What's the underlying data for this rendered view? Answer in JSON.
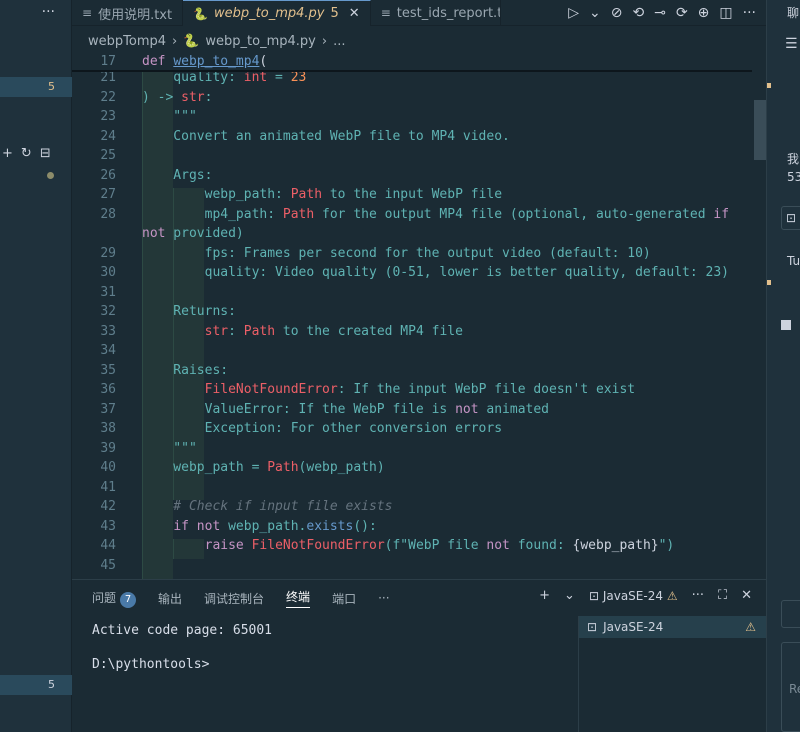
{
  "sidebar": {
    "menu": "···",
    "badge_top": "5",
    "badge_bottom": "5"
  },
  "tabs": [
    {
      "label": "使用说明.txt",
      "icon": "≡"
    },
    {
      "label": "webp_to_mp4.py",
      "icon": "py",
      "badge": "5"
    },
    {
      "label": "test_ids_report.t",
      "icon": "≡"
    }
  ],
  "breadcrumb": {
    "folder": "webpTomp4",
    "file": "webp_to_mp4.py",
    "more": "..."
  },
  "sticky": {
    "ln": "17",
    "def": "def",
    "name": "webp_to_mp4",
    "paren": "("
  },
  "code_lines": [
    {
      "ln": "21",
      "text": "    quality: int = 23"
    },
    {
      "ln": "22",
      "text": ") -> str:"
    },
    {
      "ln": "23",
      "text": "    \"\"\""
    },
    {
      "ln": "24",
      "text": "    Convert an animated WebP file to MP4 video."
    },
    {
      "ln": "25",
      "text": ""
    },
    {
      "ln": "26",
      "text": "    Args:"
    },
    {
      "ln": "27",
      "text": "        webp_path: Path to the input WebP file"
    },
    {
      "ln": "28",
      "text": "        mp4_path: Path for the output MP4 file (optional, auto-generated if"
    },
    {
      "ln": "",
      "text": "not provided)"
    },
    {
      "ln": "29",
      "text": "        fps: Frames per second for the output video (default: 10)"
    },
    {
      "ln": "30",
      "text": "        quality: Video quality (0-51, lower is better quality, default: 23)"
    },
    {
      "ln": "31",
      "text": ""
    },
    {
      "ln": "32",
      "text": "    Returns:"
    },
    {
      "ln": "33",
      "text": "        str: Path to the created MP4 file"
    },
    {
      "ln": "34",
      "text": ""
    },
    {
      "ln": "35",
      "text": "    Raises:"
    },
    {
      "ln": "36",
      "text": "        FileNotFoundError: If the input WebP file doesn't exist"
    },
    {
      "ln": "37",
      "text": "        ValueError: If the WebP file is not animated"
    },
    {
      "ln": "38",
      "text": "        Exception: For other conversion errors"
    },
    {
      "ln": "39",
      "text": "    \"\"\""
    },
    {
      "ln": "40",
      "text": "    webp_path = Path(webp_path)"
    },
    {
      "ln": "41",
      "text": ""
    },
    {
      "ln": "42",
      "text": "    # Check if input file exists"
    },
    {
      "ln": "43",
      "text": "    if not webp_path.exists():"
    },
    {
      "ln": "44",
      "text": "        raise FileNotFoundError(f\"WebP file not found: {webp_path}\")"
    },
    {
      "ln": "45",
      "text": ""
    }
  ],
  "panel": {
    "tabs": [
      {
        "label": "问题",
        "badge": "7"
      },
      {
        "label": "输出"
      },
      {
        "label": "调试控制台"
      },
      {
        "label": "终端",
        "selected": true
      },
      {
        "label": "端口"
      }
    ],
    "more": "···",
    "shell": "JavaSE-24",
    "terminal_lines": [
      "Active code page: 65001",
      "",
      "D:\\pythontools>"
    ],
    "terminal_list_item": "JavaSE-24"
  },
  "rightedge": {
    "title": "聊",
    "text1": "我",
    "text2": "53",
    "text3": "Tu",
    "text4": "Re"
  }
}
